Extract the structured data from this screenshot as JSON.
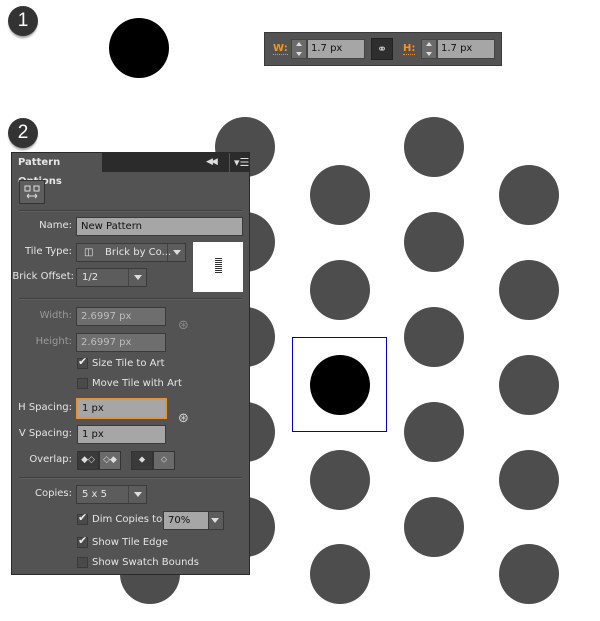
{
  "steps": {
    "one": "1",
    "two": "2"
  },
  "size_bar": {
    "width_label": "W:",
    "width_value": "1.7 px",
    "height_label": "H:",
    "height_value": "1.7 px",
    "link_icon": "chain-link-icon",
    "accent_color": "#f7941d"
  },
  "panel": {
    "title": "Pattern Options",
    "collapse_icon": "double-left-arrow-icon",
    "menu_icon": "panel-menu-icon",
    "edit_tile_icon": "pattern-tile-tool-icon",
    "name": {
      "label": "Name:",
      "value": "New Pattern"
    },
    "tile_type": {
      "label": "Tile Type:",
      "value": "Brick by Co...",
      "icon": "brick-by-column-icon"
    },
    "brick_offset": {
      "label": "Brick Offset:",
      "value": "1/2"
    },
    "width": {
      "label": "Width:",
      "value": "2.6997 px"
    },
    "height": {
      "label": "Height:",
      "value": "2.6997 px"
    },
    "size_tile_to_art": {
      "label": "Size Tile to Art",
      "checked": true
    },
    "move_tile_with_art": {
      "label": "Move Tile with Art",
      "checked": false
    },
    "h_spacing": {
      "label": "H Spacing:",
      "value": "1 px"
    },
    "v_spacing": {
      "label": "V Spacing:",
      "value": "1 px"
    },
    "overlap": {
      "label": "Overlap:",
      "glyphs": [
        "◆◇",
        "◇◆",
        "⬥",
        "⬦"
      ]
    },
    "copies": {
      "label": "Copies:",
      "value": "5 x 5"
    },
    "dim_copies": {
      "label": "Dim Copies to:",
      "checked": true,
      "value": "70%"
    },
    "show_tile_edge": {
      "label": "Show Tile Edge",
      "checked": true
    },
    "show_swatch_bounds": {
      "label": "Show Swatch Bounds",
      "checked": false
    }
  },
  "canvas": {
    "dot_color": "#4d4d4d",
    "selected_dot_color": "#000000",
    "tile_edge_color": "#0000cc"
  }
}
